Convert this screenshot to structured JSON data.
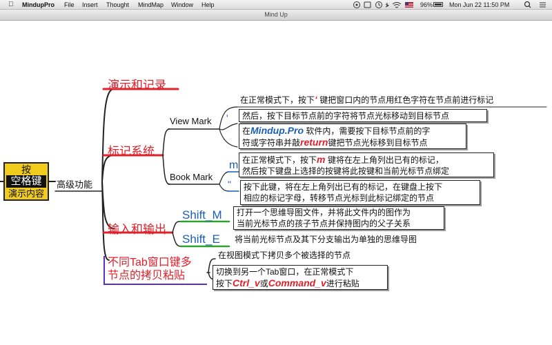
{
  "menubar": {
    "app_name": "MindupPro",
    "items": [
      "File",
      "Insert",
      "Thought",
      "MindMap",
      "Window",
      "Help"
    ],
    "battery": "96%",
    "clock": "Mon Jun 22  11:50 PM"
  },
  "window": {
    "title": "Mind Up"
  },
  "root": {
    "line1": "按",
    "line2": "空格键",
    "line3": "演示内容"
  },
  "main_topic": "高级功能",
  "branches": {
    "present": "演示和记录",
    "marking": "标记系统",
    "io": "输入和输出",
    "tab_copy": "不同Tab窗口键多节点的拷贝粘贴"
  },
  "tab_copy_lines": [
    "不同Tab窗口键多",
    "节点的拷贝粘贴"
  ],
  "view_mark": {
    "label": "View Mark",
    "key": "'",
    "note1_pre": "在正常模式下，按下",
    "note1_key": "‘",
    "note1_post": "键把窗口内的节点用红色字符在节点前进行标记",
    "note2": "然后，按下目标节点前的字符将节点光标移动到目标节点",
    "note3_pre": "在",
    "note3_brand": "Mindup.Pro",
    "note3_mid": "软件内，需要按下目标节点前的字",
    "note3_l2_pre": "符或字符串并敲",
    "note3_key": "return",
    "note3_l2_post": "键把节点光标移到目标节点"
  },
  "book_mark": {
    "label": "Book Mark",
    "key1": "m",
    "key2": "\"",
    "note1_pre": "在正常模式下，按下",
    "note1_key": "m",
    "note1_post": "键将在左上角列出已有的标记，",
    "note1_l2": "然后按下键盘上选择的按键将此按键和当前光标节点绑定",
    "note2_l1": "按下此键，将在左上角列出已有的标记，在键盘上按下",
    "note2_l2": "相应的标记字母，转移节点光标到此标记绑定的节点"
  },
  "shift_m": {
    "label": "Shift_M",
    "note_l1": "打开一个思维导图文件，并将此文件内的图作为",
    "note_l2": "当前光标节点的孩子节点并保持图内的父子关系"
  },
  "shift_e": {
    "label": "Shift_E",
    "note": "将当前光标节点及其下分支输出为单独的思维导图"
  },
  "copy_paste": {
    "note1": "在视图模式下拷贝多个被选择的节点",
    "note2_l1": "切换到另一个Tab窗口，在正常模式下",
    "note2_pre": "按下",
    "key_ctrl": "Ctrl_v",
    "or": "或",
    "key_cmd": "Command_v",
    "note2_post": "进行粘贴"
  },
  "colors": {
    "branch_red": "#e0202a",
    "label_blue": "#1b5fb0",
    "root_yellow": "#f2cc1c"
  }
}
